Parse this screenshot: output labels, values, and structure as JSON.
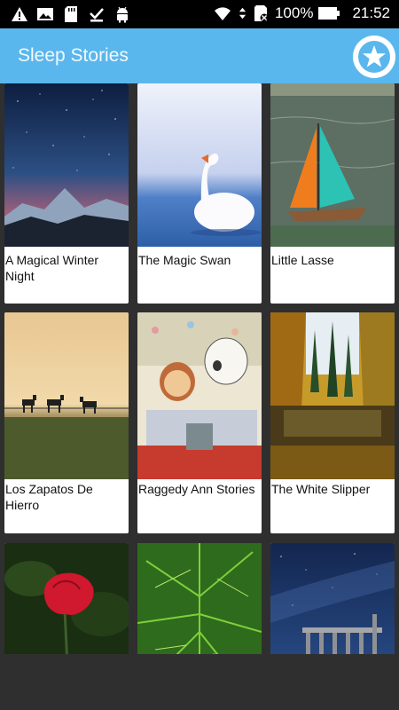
{
  "status_bar": {
    "battery_text": "100%",
    "time": "21:52",
    "left_icons": [
      "alert-icon",
      "image-icon",
      "sd-card-icon",
      "download-done-icon",
      "android-icon"
    ],
    "right_icons": [
      "wifi-icon",
      "data-arrows-icon",
      "sim-no-icon",
      "battery-icon"
    ]
  },
  "app_bar": {
    "title": "Sleep Stories",
    "favorite_icon": "star-icon",
    "color": "#5ab7ed"
  },
  "stories": [
    {
      "title": "A Magical Winter Night"
    },
    {
      "title": "The Magic Swan"
    },
    {
      "title": "Little Lasse"
    },
    {
      "title": "Los Zapatos De Hierro"
    },
    {
      "title": "Raggedy Ann Stories"
    },
    {
      "title": "The White Slipper"
    },
    {
      "title": ""
    },
    {
      "title": ""
    },
    {
      "title": ""
    }
  ]
}
